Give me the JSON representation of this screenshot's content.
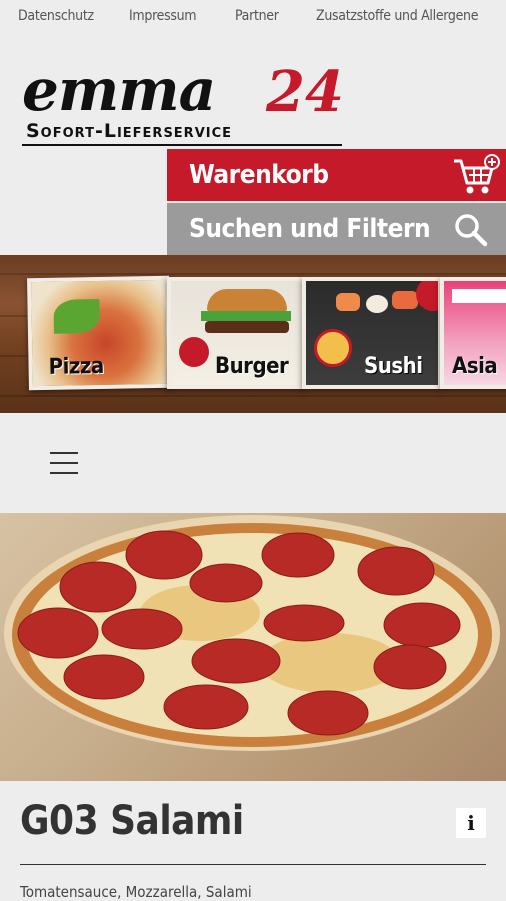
{
  "topnav": {
    "items": [
      "Datenschutz",
      "Impressum",
      "Partner",
      "Zusatzstoffe und Allergene"
    ]
  },
  "logo": {
    "name": "emma",
    "number": "24",
    "tagline": "Sofort-Lieferservice"
  },
  "cart": {
    "label": "Warenkorb",
    "icon": "shopping-cart-plus-icon"
  },
  "search": {
    "label": "Suchen und Filtern",
    "icon": "search-icon"
  },
  "categories": [
    {
      "label": "Pizza"
    },
    {
      "label": "Burger"
    },
    {
      "label": "Sushi"
    },
    {
      "label": "Asia"
    }
  ],
  "menu": {
    "icon": "hamburger-menu-icon"
  },
  "product": {
    "title": "G03 Salami",
    "info_label": "i",
    "description": "Tomatensauce, Mozzarella, Salami"
  },
  "colors": {
    "brand_red": "#c51a29",
    "search_gray": "#9b9b9b",
    "background": "#ededed"
  }
}
